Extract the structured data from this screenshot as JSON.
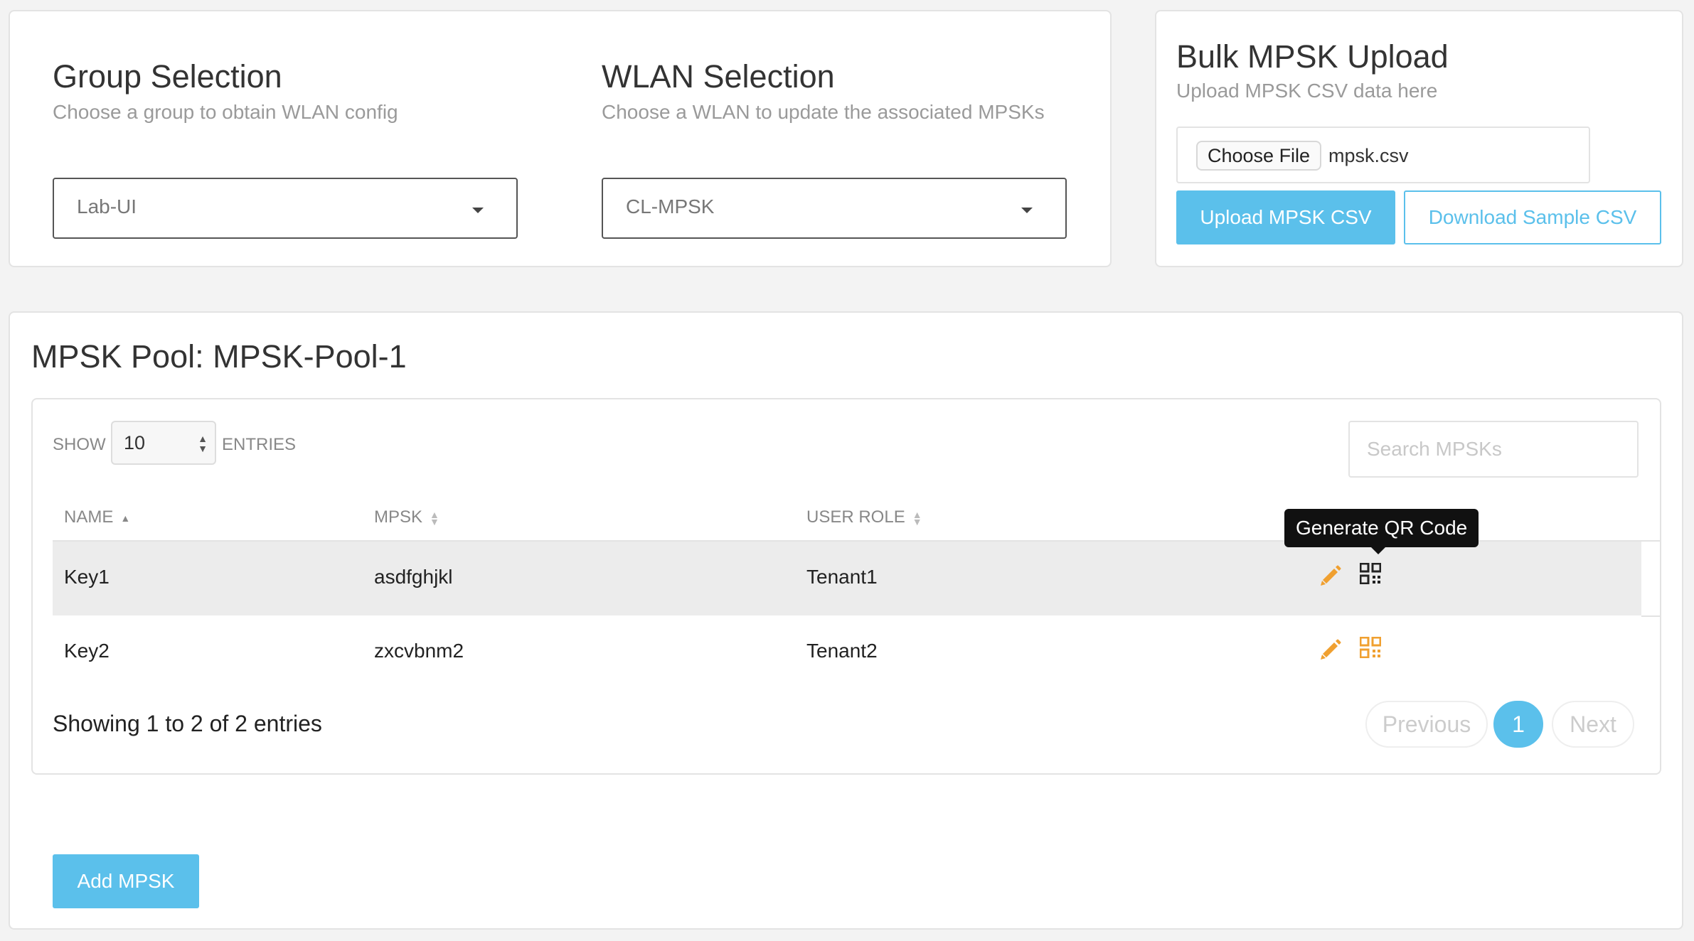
{
  "group": {
    "title": "Group Selection",
    "subtitle": "Choose a group to obtain WLAN config",
    "selected": "Lab-UI"
  },
  "wlan": {
    "title": "WLAN Selection",
    "subtitle": "Choose a WLAN to update the associated MPSKs",
    "selected": "CL-MPSK"
  },
  "bulk": {
    "title": "Bulk MPSK Upload",
    "subtitle": "Upload MPSK CSV data here",
    "choose_file_label": "Choose File",
    "file_name": "mpsk.csv",
    "upload_label": "Upload MPSK CSV",
    "sample_label": "Download Sample CSV"
  },
  "pool": {
    "title": "MPSK Pool: MPSK-Pool-1",
    "show_label": "SHOW",
    "page_length": "10",
    "entries_label": "ENTRIES",
    "search_placeholder": "Search MPSKs",
    "columns": [
      "NAME",
      "MPSK",
      "USER ROLE"
    ],
    "rows": [
      {
        "name": "Key1",
        "mpsk": "asdfghjkl",
        "role": "Tenant1"
      },
      {
        "name": "Key2",
        "mpsk": "zxcvbnm2",
        "role": "Tenant2"
      }
    ],
    "tooltip": "Generate QR Code",
    "info": "Showing 1 to 2 of 2 entries",
    "pagination": {
      "previous": "Previous",
      "current": "1",
      "next": "Next"
    },
    "add_label": "Add MPSK"
  },
  "colors": {
    "accent": "#5bc0eb",
    "edit_icon": "#f0a030",
    "qr_hover": "#222222"
  },
  "icons": [
    "pencil-icon",
    "qr-code-icon",
    "sort-asc-icon",
    "sort-both-icon",
    "caret-down-icon"
  ]
}
